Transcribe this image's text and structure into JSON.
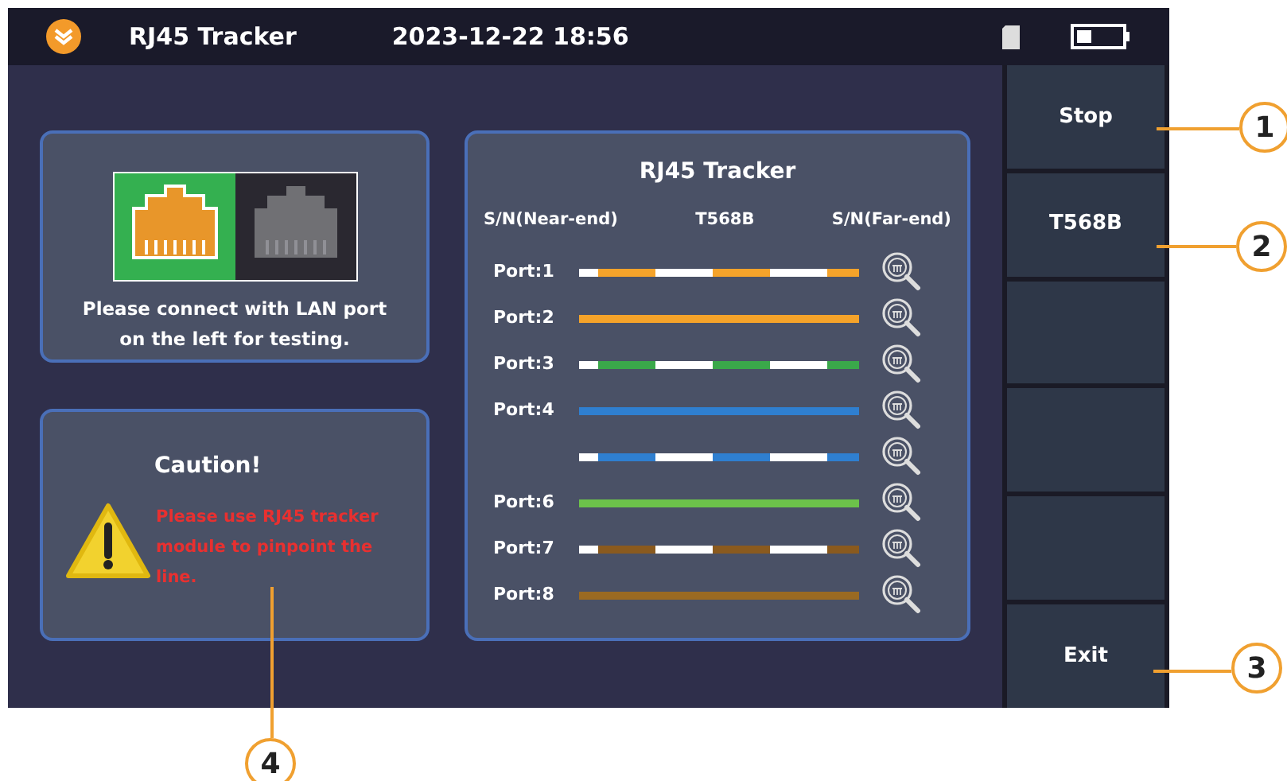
{
  "status_bar": {
    "title": "RJ45 Tracker",
    "datetime": "2023-12-22 18:56"
  },
  "connect_card": {
    "message": "Please connect with LAN port on the left for testing."
  },
  "caution_card": {
    "title": "Caution!",
    "message": "Please use RJ45 tracker module to pinpoint the line."
  },
  "tracker": {
    "title": "RJ45 Tracker",
    "headers": [
      "S/N(Near-end)",
      "T568B",
      "S/N(Far-end)"
    ],
    "wires": [
      {
        "label": "Port:1",
        "kind": "striped",
        "color": "#f5a32a"
      },
      {
        "label": "Port:2",
        "kind": "solid",
        "color": "#f5a32a"
      },
      {
        "label": "Port:3",
        "kind": "striped",
        "color": "#3aa84a"
      },
      {
        "label": "Port:4",
        "kind": "solid",
        "color": "#2f7fd0"
      },
      {
        "kind": "striped",
        "color": "#2f7fd0"
      },
      {
        "label": "Port:6",
        "kind": "solid",
        "color": "#6cc24a"
      },
      {
        "label": "Port:7",
        "kind": "striped",
        "color": "#8a5a1e"
      },
      {
        "label": "Port:8",
        "kind": "solid",
        "color": "#9a6a22"
      }
    ]
  },
  "side_buttons": [
    {
      "kind": "labeled",
      "label": "Stop"
    },
    {
      "kind": "labeled",
      "label": "T568B"
    },
    {
      "kind": "blank"
    },
    {
      "kind": "blank"
    },
    {
      "kind": "blank"
    },
    {
      "kind": "labeled",
      "label": "Exit"
    }
  ],
  "callouts": [
    "1",
    "2",
    "3",
    "4"
  ]
}
